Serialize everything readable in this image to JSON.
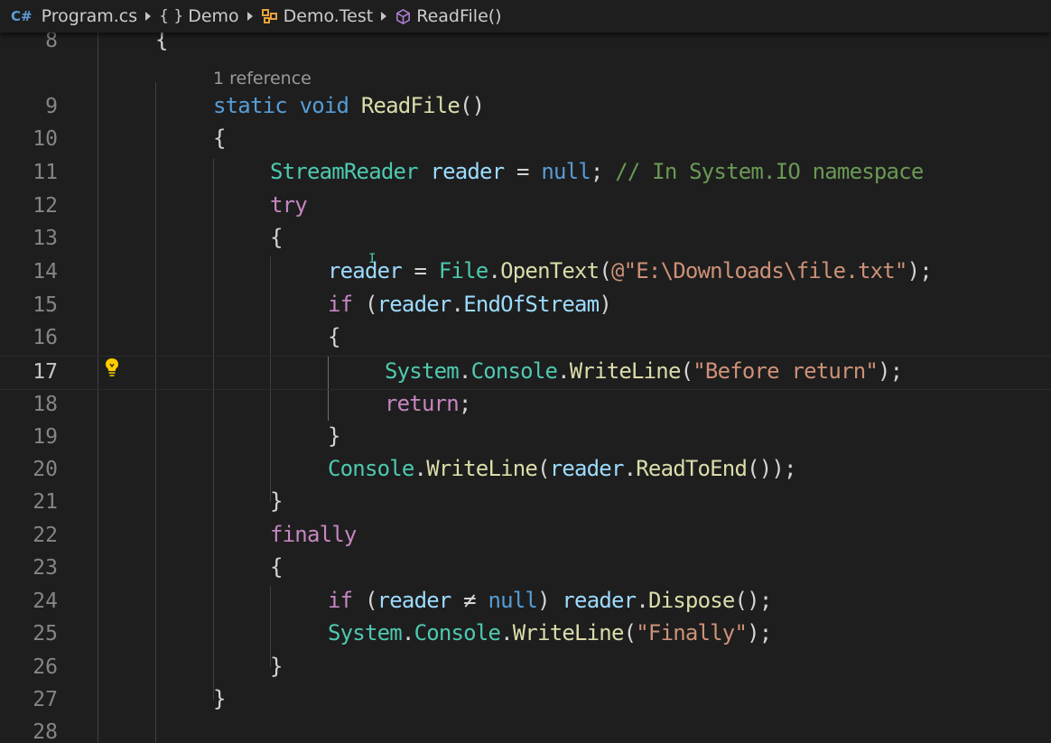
{
  "breadcrumb": {
    "file_icon": "csharp-file-icon",
    "file": "Program.cs",
    "namespace_icon": "namespace-braces-icon",
    "namespace_glyph": "{ }",
    "namespace": "Demo",
    "class_icon": "class-icon",
    "class": "Demo.Test",
    "method_icon": "method-cube-icon",
    "method": "ReadFile()"
  },
  "editor": {
    "codelens": "1 reference",
    "active_line": "17",
    "lightbulb_icon": "lightbulb-icon",
    "lines": [
      {
        "number": "8",
        "tokens": [
          "{"
        ]
      },
      {
        "number": "9",
        "tokens": [
          "static",
          " ",
          "void",
          " ",
          "ReadFile",
          "()"
        ]
      },
      {
        "number": "10",
        "tokens": [
          "{"
        ]
      },
      {
        "number": "11",
        "tokens": [
          "StreamReader",
          " ",
          "reader",
          " = ",
          "null",
          "; ",
          "// In System.IO namespace"
        ]
      },
      {
        "number": "12",
        "tokens": [
          "try"
        ]
      },
      {
        "number": "13",
        "tokens": [
          "{"
        ]
      },
      {
        "number": "14",
        "tokens": [
          "reader",
          " = ",
          "File",
          ".",
          "OpenText",
          "(",
          "@\"E:\\Downloads\\file.txt\"",
          ");"
        ]
      },
      {
        "number": "15",
        "tokens": [
          "if",
          " (",
          "reader",
          ".",
          "EndOfStream",
          ")"
        ]
      },
      {
        "number": "16",
        "tokens": [
          "{"
        ]
      },
      {
        "number": "17",
        "tokens": [
          "System",
          ".",
          "Console",
          ".",
          "WriteLine",
          "(",
          "\"Before return\"",
          ");"
        ]
      },
      {
        "number": "18",
        "tokens": [
          "return",
          ";"
        ]
      },
      {
        "number": "19",
        "tokens": [
          "}"
        ]
      },
      {
        "number": "20",
        "tokens": [
          "Console",
          ".",
          "WriteLine",
          "(",
          "reader",
          ".",
          "ReadToEnd",
          "());"
        ]
      },
      {
        "number": "21",
        "tokens": [
          "}"
        ]
      },
      {
        "number": "22",
        "tokens": [
          "finally"
        ]
      },
      {
        "number": "23",
        "tokens": [
          "{"
        ]
      },
      {
        "number": "24",
        "tokens": [
          "if",
          " (",
          "reader",
          " ≠ ",
          "null",
          ") ",
          "reader",
          ".",
          "Dispose",
          "();"
        ]
      },
      {
        "number": "25",
        "tokens": [
          "System",
          ".",
          "Console",
          ".",
          "WriteLine",
          "(",
          "\"Finally\"",
          ");"
        ]
      },
      {
        "number": "26",
        "tokens": [
          "}"
        ]
      },
      {
        "number": "27",
        "tokens": [
          "}"
        ]
      },
      {
        "number": "28",
        "tokens": [
          ""
        ]
      }
    ]
  },
  "colors": {
    "background": "#1e1e1e",
    "keyword": "#569cd6",
    "control": "#c586c0",
    "type": "#4ec9b0",
    "function": "#dcdcaa",
    "variable": "#9cdcfe",
    "string": "#ce9178",
    "comment": "#6a9955"
  }
}
